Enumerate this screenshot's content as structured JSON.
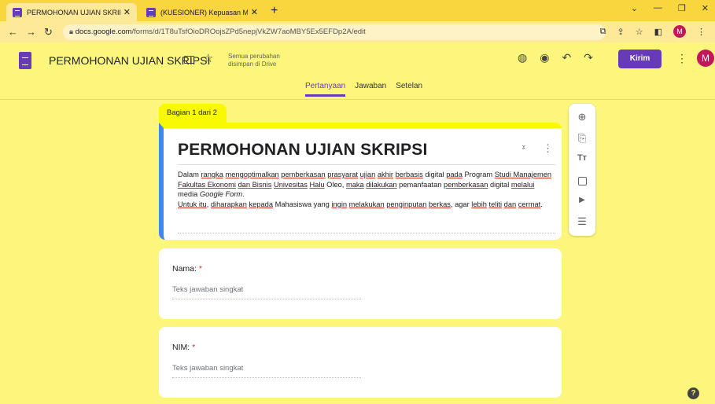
{
  "browser": {
    "tabs": [
      {
        "title": "PERMOHONAN UJIAN SKRIPSI -"
      },
      {
        "title": "(KUESIONER) Kepuasan Mahasis"
      }
    ],
    "new_tab": "+",
    "url_host": "docs.google.com",
    "url_path": "/forms/d/1T8uTsfOioDROojsZPd5nepjVkZW7aoMBY5Ex5EFDp2A/edit",
    "profile_initial": "M"
  },
  "header": {
    "form_name": "PERMOHONAN UJIAN SKRIPSI",
    "saved_status": "Semua perubahan disimpan di Drive",
    "send_label": "Kirim",
    "user_initial": "M"
  },
  "tabs": [
    {
      "label": "Pertanyaan",
      "active": true
    },
    {
      "label": "Jawaban",
      "active": false
    },
    {
      "label": "Setelan",
      "active": false
    }
  ],
  "section": {
    "label": "Bagian 1 dari 2",
    "title": "PERMOHONAN UJIAN SKRIPSI",
    "description_parts": [
      {
        "text": "Dalam ",
        "u": false
      },
      {
        "text": "rangka",
        "u": true
      },
      {
        "text": " ",
        "u": false
      },
      {
        "text": "mengoptimalkan",
        "u": true
      },
      {
        "text": " ",
        "u": false
      },
      {
        "text": "pemberkasan",
        "u": true
      },
      {
        "text": " ",
        "u": false
      },
      {
        "text": "prasyarat",
        "u": true
      },
      {
        "text": " ",
        "u": false
      },
      {
        "text": "ujian",
        "u": true
      },
      {
        "text": " ",
        "u": false
      },
      {
        "text": "akhir",
        "u": true
      },
      {
        "text": " ",
        "u": false
      },
      {
        "text": "berbasis",
        "u": true
      },
      {
        "text": " digital ",
        "u": false
      },
      {
        "text": "pada",
        "u": true
      },
      {
        "text": " Program ",
        "u": false
      },
      {
        "text": "Studi Manajemen Fakultas Ekonomi",
        "u": true
      },
      {
        "text": " ",
        "u": false
      },
      {
        "text": "dan Bisnis",
        "u": true
      },
      {
        "text": " ",
        "u": false
      },
      {
        "text": "Univesitas",
        "u": true
      },
      {
        "text": " ",
        "u": false
      },
      {
        "text": "Halu",
        "u": true
      },
      {
        "text": " Oleo, ",
        "u": false
      },
      {
        "text": "maka",
        "u": true
      },
      {
        "text": " ",
        "u": false
      },
      {
        "text": "dilakukan",
        "u": true
      },
      {
        "text": " pemanfaatan ",
        "u": false
      },
      {
        "text": "pemberkasan",
        "u": true
      },
      {
        "text": " digital ",
        "u": false
      },
      {
        "text": "melalui",
        "u": true
      },
      {
        "text": " media ",
        "u": false
      },
      {
        "text": "Google Form",
        "u": false,
        "i": true
      },
      {
        "text": ".",
        "u": false,
        "br": true
      },
      {
        "text": "Untuk itu",
        "u": true
      },
      {
        "text": ", ",
        "u": false
      },
      {
        "text": "diharapkan",
        "u": true
      },
      {
        "text": " ",
        "u": false
      },
      {
        "text": "kepada",
        "u": true
      },
      {
        "text": " Mahasiswa yang ",
        "u": false
      },
      {
        "text": "ingin",
        "u": true
      },
      {
        "text": " ",
        "u": false
      },
      {
        "text": "melakukan",
        "u": true
      },
      {
        "text": " ",
        "u": false
      },
      {
        "text": "penginputan",
        "u": true
      },
      {
        "text": " ",
        "u": false
      },
      {
        "text": "berkas",
        "u": true
      },
      {
        "text": ", agar ",
        "u": false
      },
      {
        "text": "lebih",
        "u": true
      },
      {
        "text": " ",
        "u": false
      },
      {
        "text": "teliti",
        "u": true
      },
      {
        "text": " ",
        "u": false
      },
      {
        "text": "dan",
        "u": true
      },
      {
        "text": " ",
        "u": false
      },
      {
        "text": "cermat",
        "u": true
      },
      {
        "text": ".",
        "u": false
      }
    ]
  },
  "questions": [
    {
      "label": "Nama:",
      "required_mark": "*",
      "placeholder": "Teks jawaban singkat"
    },
    {
      "label": "NIM:",
      "required_mark": "*",
      "placeholder": "Teks jawaban singkat"
    }
  ],
  "toolbar": {
    "items": [
      "add-question",
      "import-questions",
      "add-title",
      "add-image",
      "add-video",
      "add-section"
    ],
    "title_glyph": "Tт"
  },
  "help": "?"
}
